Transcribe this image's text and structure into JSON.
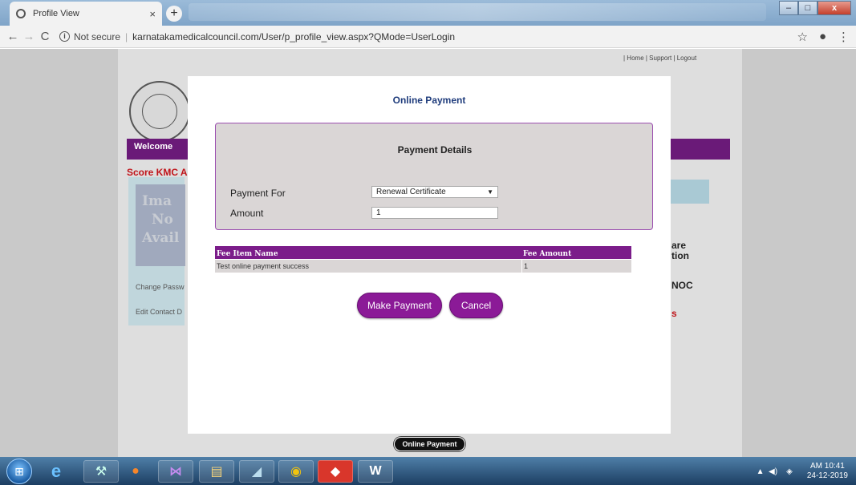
{
  "browser": {
    "tab_title": "Profile View",
    "tab_close": "×",
    "new_tab": "+",
    "not_secure": "Not secure",
    "url": "karnatakamedicalcouncil.com/User/p_profile_view.aspx?QMode=UserLogin",
    "window_buttons": [
      "–",
      "□",
      "x"
    ]
  },
  "page": {
    "top_links": "| Home | Support | Logout",
    "welcome": "Welcome",
    "score_kmc": "Score KMC A",
    "image_placeholder": [
      "Ima",
      "No",
      "Avail"
    ],
    "side_links": [
      "Change Passw",
      "Edit Contact D"
    ],
    "right_fragments": [
      "are",
      "tion",
      "NOC",
      "s"
    ]
  },
  "modal": {
    "title": "Online Payment",
    "details_title": "Payment Details",
    "payment_for_label": "Payment For",
    "payment_for_value": "Renewal Certificate",
    "amount_label": "Amount",
    "amount_value": "1",
    "table": {
      "headers": [
        "Fee Item Name",
        "Fee Amount"
      ],
      "rows": [
        [
          "Test online payment success",
          "1"
        ]
      ]
    },
    "make_payment": "Make Payment",
    "cancel": "Cancel"
  },
  "footer_pill": "Online Payment",
  "taskbar": {
    "time": "AM 10:41",
    "date": "24-12-2019"
  }
}
